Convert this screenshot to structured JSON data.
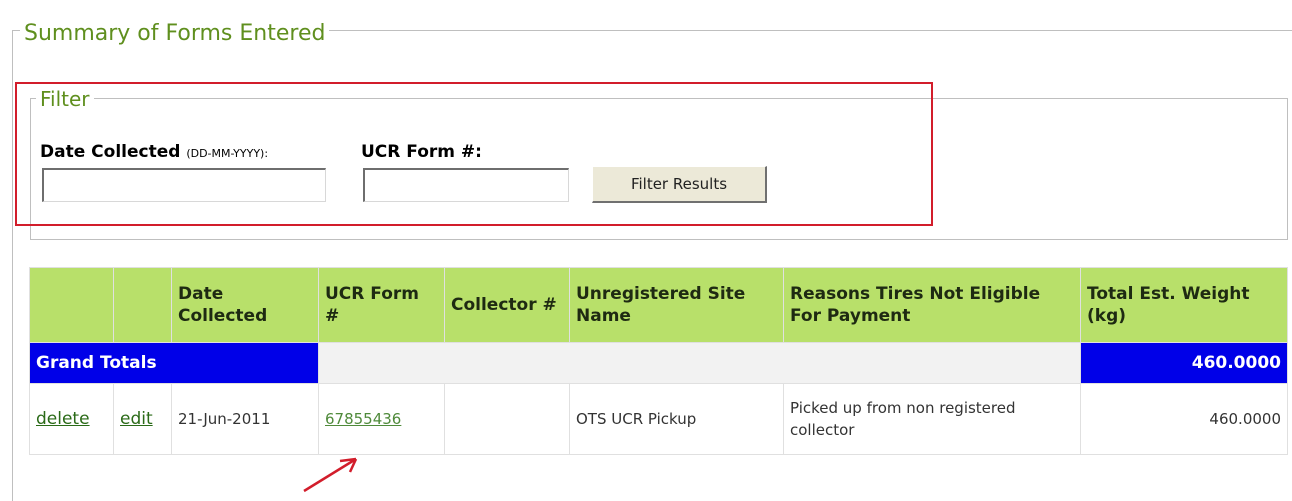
{
  "summary": {
    "legend": "Summary of Forms Entered"
  },
  "filter": {
    "legend": "Filter",
    "date_label": "Date Collected",
    "date_format": "(DD-MM-YYYY):",
    "date_value": "",
    "ucr_label": "UCR Form #:",
    "ucr_value": "",
    "button_label": "Filter Results"
  },
  "table": {
    "headers": [
      "",
      "",
      "Date Collected",
      "UCR Form #",
      "Collector #",
      "Unregistered Site Name",
      "Reasons Tires Not Eligible For Payment",
      "Total Est. Weight (kg)"
    ],
    "grand_totals": {
      "label": "Grand Totals",
      "value": "460.0000"
    },
    "rows": [
      {
        "delete": "delete",
        "edit": "edit",
        "date_collected": "21-Jun-2011",
        "ucr_form": "67855436",
        "collector": "",
        "site_name": "OTS UCR Pickup",
        "reason": "Picked up from non registered collector",
        "weight": "460.0000"
      }
    ]
  },
  "colors": {
    "header_bg": "#b8e06a",
    "totals_bg": "#0000e8",
    "legend_text": "#5f8f1e",
    "highlight_box": "#d21d2b",
    "annotation_arrow": "#d21d2b"
  }
}
